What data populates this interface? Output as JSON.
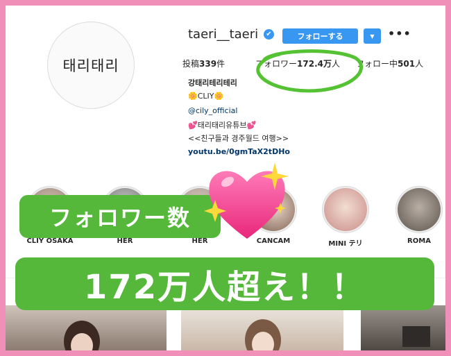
{
  "profile": {
    "avatar_text": "태리태리",
    "username": "taeri__taeri",
    "verified_icon": "verified-badge-icon",
    "follow_label": "フォローする",
    "dropdown_icon": "chevron-down-icon",
    "more_icon": "more-options-icon",
    "more_text": "•••",
    "verified_glyph": "✔",
    "dropdown_glyph": "▼"
  },
  "stats": {
    "posts_label": "投稿",
    "posts_value": "339",
    "posts_unit": "件",
    "followers_label": "フォロワー",
    "followers_value": "172.4万",
    "followers_unit": "人",
    "following_label": "フォロー中",
    "following_value": "501",
    "following_unit": "人"
  },
  "bio": {
    "name": "강태리테리테리",
    "line1": "🌼CLIY🌼",
    "line2": "@cily_official",
    "line3": "💕태리태리유튜브💕",
    "line4": "<<친구들과 경주월드 여행>>",
    "url": "youtu.be/0gmTaX2tDHo"
  },
  "highlights": [
    {
      "label": "CLIY OSAKA"
    },
    {
      "label": "HER"
    },
    {
      "label": "HER"
    },
    {
      "label": "CANCAM"
    },
    {
      "label": "MINI テリ"
    },
    {
      "label": "ROMA"
    }
  ],
  "overlay": {
    "caption_small": "フォロワー数",
    "caption_big": "172万人超え！！",
    "heart_icon": "sparkling-heart-icon"
  },
  "colors": {
    "frame_pink": "#f08fb8",
    "instagram_blue": "#3897f0",
    "caption_green": "#55b83a",
    "annotation_green": "#55c234"
  }
}
